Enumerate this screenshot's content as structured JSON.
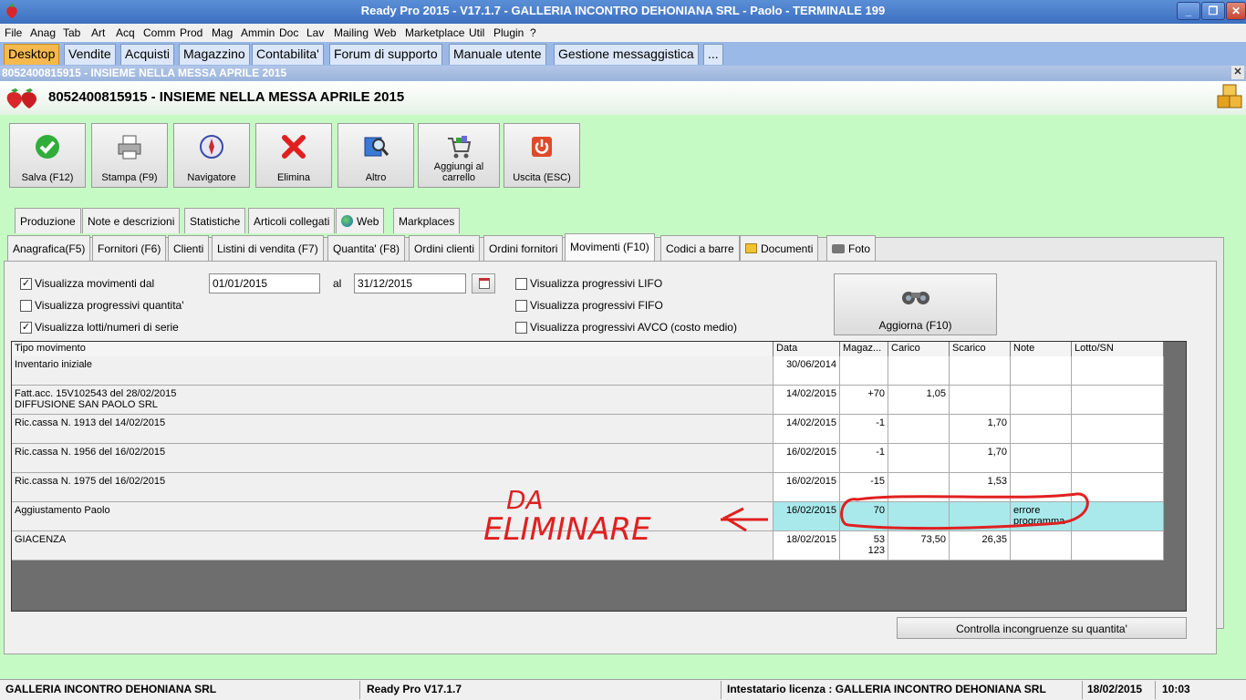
{
  "window": {
    "title": "Ready Pro 2015 - V17.1.7 - GALLERIA INCONTRO DEHONIANA SRL - Paolo - TERMINALE 199"
  },
  "menu": [
    "File",
    "Anag",
    "Tab",
    "Art",
    "Acq",
    "Comm",
    "Prod",
    "Mag",
    "Ammin",
    "Doc",
    "Lav",
    "Mailing",
    "Web",
    "Marketplace",
    "Util",
    "Plugin",
    "?"
  ],
  "top_tabs": [
    "Desktop",
    "Vendite",
    "Acquisti",
    "Magazzino",
    "Contabilita'",
    "Forum di supporto",
    "Manuale utente",
    "Gestione messaggistica",
    "..."
  ],
  "doc_strip": "8052400815915 - INSIEME NELLA MESSA APRILE 2015",
  "heading": "8052400815915 - INSIEME NELLA MESSA APRILE 2015",
  "toolbar": {
    "save": "Salva (F12)",
    "print": "Stampa (F9)",
    "navigator": "Navigatore",
    "delete": "Elimina",
    "other": "Altro",
    "cart_line1": "Aggiungi al",
    "cart_line2": "carrello",
    "exit": "Uscita (ESC)"
  },
  "tabs_row1": [
    "Produzione",
    "Note e descrizioni",
    "Statistiche",
    "Articoli collegati",
    "Web",
    "Markplaces"
  ],
  "tabs_row2": [
    "Anagrafica(F5)",
    "Fornitori (F6)",
    "Clienti",
    "Listini di vendita (F7)",
    "Quantita' (F8)",
    "Ordini clienti",
    "Ordini fornitori",
    "Movimenti (F10)",
    "Codici a barre",
    "Documenti",
    "Foto"
  ],
  "filters": {
    "show_movements": "Visualizza movimenti dal",
    "date_from": "01/01/2015",
    "al": "al",
    "date_to": "31/12/2015",
    "show_qty_progressive": "Visualizza progressivi quantita'",
    "show_lots": "Visualizza lotti/numeri di serie",
    "show_lifo": "Visualizza progressivi LIFO",
    "show_fifo": "Visualizza progressivi FIFO",
    "show_avco": "Visualizza progressivi AVCO (costo medio)",
    "refresh": "Aggiorna (F10)"
  },
  "grid": {
    "columns": [
      "Tipo movimento",
      "Data",
      "Magaz...",
      "Carico",
      "Scarico",
      "Note",
      "Lotto/SN"
    ],
    "rows": [
      {
        "tipo1": "Inventario iniziale",
        "tipo2": "",
        "data": "30/06/2014",
        "mag1": "",
        "mag2": "",
        "carico": "",
        "scarico": "",
        "note1": "",
        "note2": "",
        "lotto": ""
      },
      {
        "tipo1": "Fatt.acc. 15V102543 del 28/02/2015",
        "tipo2": "DIFFUSIONE SAN PAOLO SRL",
        "data": "14/02/2015",
        "mag1": "+70",
        "mag2": "",
        "carico": "1,05",
        "scarico": "",
        "note1": "",
        "note2": "",
        "lotto": ""
      },
      {
        "tipo1": "Ric.cassa N. 1913 del 14/02/2015",
        "tipo2": "",
        "data": "14/02/2015",
        "mag1": "-1",
        "mag2": "",
        "carico": "",
        "scarico": "1,70",
        "note1": "",
        "note2": "",
        "lotto": ""
      },
      {
        "tipo1": "Ric.cassa N. 1956 del 16/02/2015",
        "tipo2": "",
        "data": "16/02/2015",
        "mag1": "-1",
        "mag2": "",
        "carico": "",
        "scarico": "1,70",
        "note1": "",
        "note2": "",
        "lotto": ""
      },
      {
        "tipo1": "Ric.cassa N. 1975 del 16/02/2015",
        "tipo2": "",
        "data": "16/02/2015",
        "mag1": "-15",
        "mag2": "",
        "carico": "",
        "scarico": "1,53",
        "note1": "",
        "note2": "",
        "lotto": ""
      },
      {
        "tipo1": "Aggiustamento Paolo",
        "tipo2": "",
        "data": "16/02/2015",
        "mag1": "70",
        "mag2": "",
        "carico": "",
        "scarico": "",
        "note1": "errore",
        "note2": "programma",
        "lotto": ""
      },
      {
        "tipo1": "GIACENZA",
        "tipo2": "",
        "data": "18/02/2015",
        "mag1": "53",
        "mag2": "123",
        "carico": "73,50",
        "scarico": "26,35",
        "note1": "",
        "note2": "",
        "lotto": ""
      }
    ]
  },
  "annotation": {
    "line1": "DA",
    "line2": "ELIMINARE"
  },
  "check_button": "Controlla incongruenze su quantita'",
  "status": {
    "company": "GALLERIA INCONTRO DEHONIANA SRL",
    "version": "Ready Pro V17.1.7",
    "license": "Intestatario licenza : GALLERIA INCONTRO DEHONIANA SRL",
    "date": "18/02/2015",
    "time": "10:03"
  }
}
